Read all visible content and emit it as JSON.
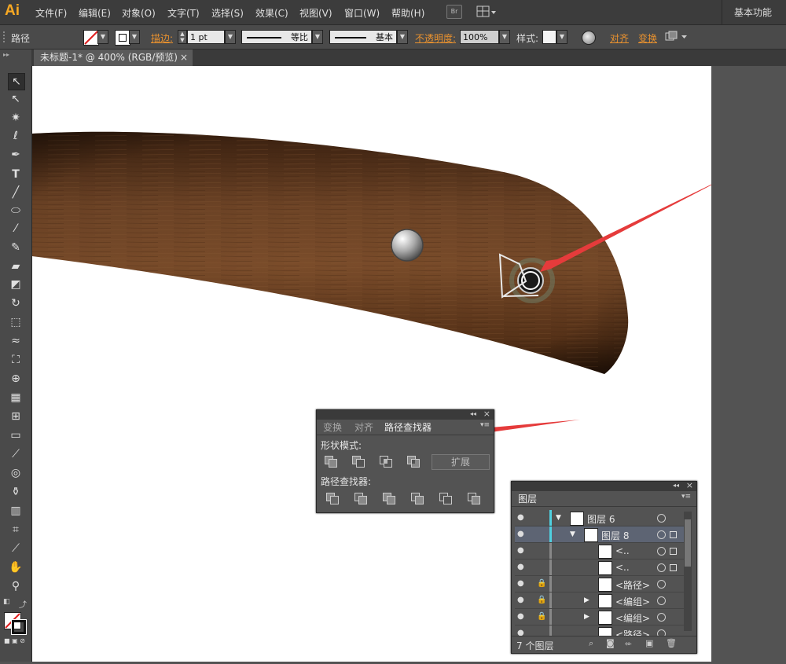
{
  "app": {
    "logo": "Ai",
    "workspace": "基本功能"
  },
  "menu": [
    "文件(F)",
    "编辑(E)",
    "对象(O)",
    "文字(T)",
    "选择(S)",
    "效果(C)",
    "视图(V)",
    "窗口(W)",
    "帮助(H)"
  ],
  "menubar_buttons": {
    "bridge": "Br",
    "arrange": "arrange-icon"
  },
  "control_bar": {
    "object_type": "路径",
    "stroke_label": "描边:",
    "stroke_weight": "1 pt",
    "profile": "等比",
    "brush": "基本",
    "opacity_label": "不透明度:",
    "opacity_value": "100%",
    "style_label": "样式:",
    "align": "对齐",
    "transform": "变换"
  },
  "document_tab": {
    "title": "未标题-1* @ 400% (RGB/预览)",
    "close": "×"
  },
  "pathfinder_panel": {
    "tabs": [
      "变换",
      "对齐",
      "路径查找器"
    ],
    "active_tab": 2,
    "shape_modes_label": "形状模式:",
    "expand_button": "扩展",
    "pathfinders_label": "路径查找器:"
  },
  "layers_panel": {
    "tab": "图层",
    "rows": [
      {
        "name": "图层 6",
        "expanded": true,
        "indent": 0,
        "locked": false,
        "selected": false
      },
      {
        "name": "图层 8",
        "expanded": true,
        "indent": 1,
        "locked": false,
        "selected": true
      },
      {
        "name": "<..",
        "expanded": false,
        "indent": 2,
        "locked": false,
        "selected": false
      },
      {
        "name": "<..",
        "expanded": false,
        "indent": 2,
        "locked": false,
        "selected": false
      },
      {
        "name": "<路径>",
        "expanded": false,
        "indent": 2,
        "locked": true,
        "selected": false
      },
      {
        "name": "<编组>",
        "expanded": false,
        "indent": 2,
        "locked": true,
        "selected": false
      },
      {
        "name": "<编组>",
        "expanded": false,
        "indent": 2,
        "locked": true,
        "selected": false
      },
      {
        "name": "<路径>",
        "expanded": false,
        "indent": 2,
        "locked": false,
        "selected": false
      }
    ],
    "footer": "7 个图层"
  },
  "colors": {
    "accent_orange": "#e8912f",
    "arrow_red": "#e53b3b",
    "wood_dark": "#3d2412",
    "wood_mid": "#6b4023"
  }
}
